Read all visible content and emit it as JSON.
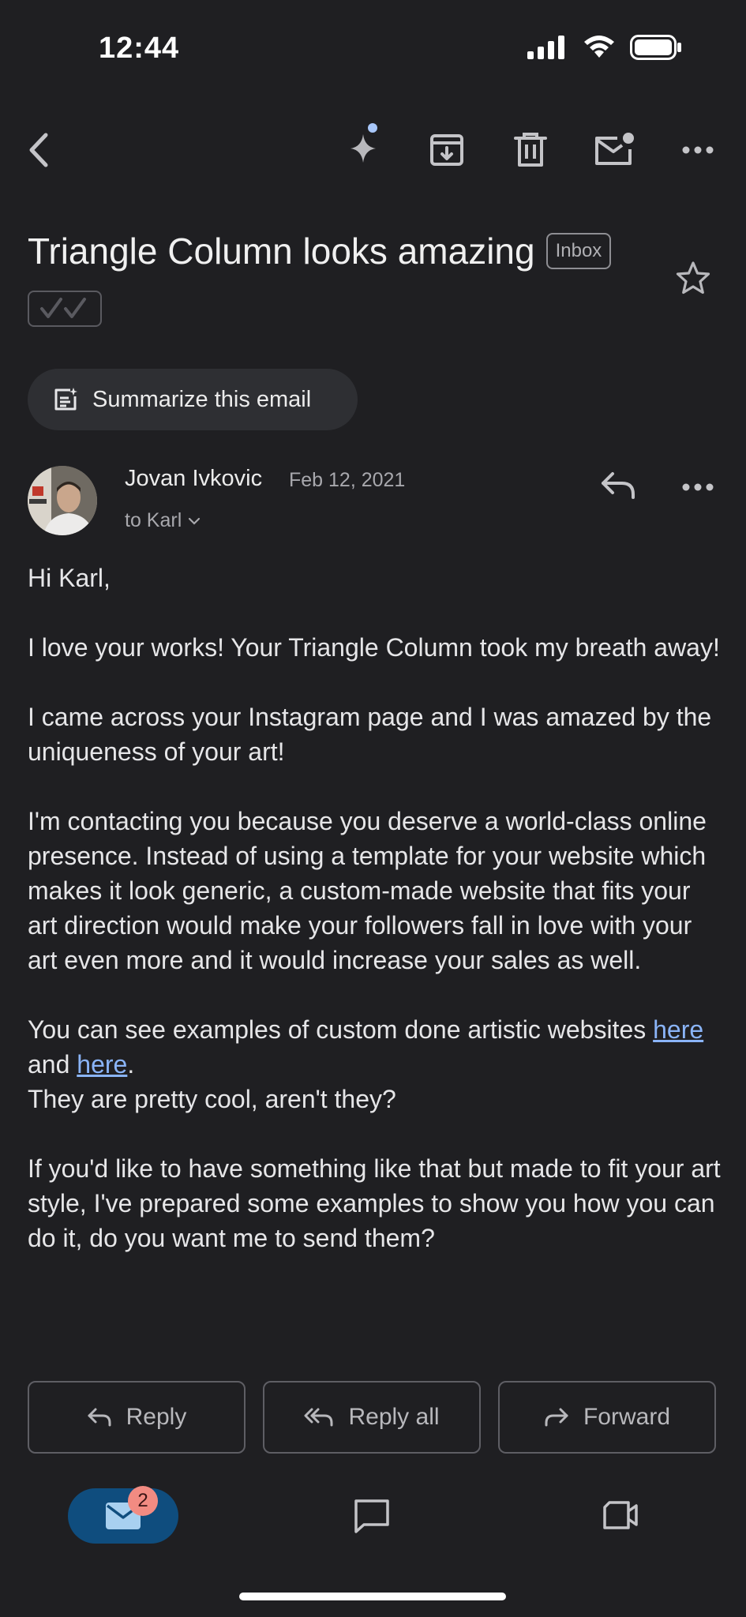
{
  "status_bar": {
    "time": "12:44"
  },
  "email": {
    "subject": "Triangle Column looks amazing",
    "label": "Inbox",
    "summarize_label": "Summarize this email",
    "sender": "Jovan Ivkovic",
    "date": "Feb 12, 2021",
    "recipient": "to Karl",
    "greeting": "Hi Karl,",
    "para1": "I love your works! Your Triangle Column took my breath away!",
    "para2": "I came across your Instagram page and I was amazed by the uniqueness of your art!",
    "para3": "I'm contacting you because you deserve a world-class online presence. Instead of using a template for your website which makes it look generic, a custom-made website that fits your art direction would make your followers fall in love with your art even more and it would increase your sales as well.",
    "para4_a": "You can see examples of custom done artistic websites ",
    "link1": "here",
    "para4_b": " and ",
    "link2": "here",
    "para4_c": ".",
    "para4_line2": "They are pretty cool, aren't they?",
    "para5": "If you'd like to have something like that but made to fit your art style, I've prepared some examples to show you how you can do it, do you want me to send them?"
  },
  "actions": {
    "reply": "Reply",
    "reply_all": "Reply all",
    "forward": "Forward"
  },
  "bottom_nav": {
    "mail_badge": "2"
  },
  "icons": {
    "back": "chevron-left-icon",
    "gemini": "sparkle-icon",
    "archive": "archive-icon",
    "delete": "trash-icon",
    "mark_unread": "mail-unread-icon",
    "more": "more-horizontal-icon",
    "star": "star-icon"
  },
  "colors": {
    "background": "#1f1f22",
    "link": "#8ab4f8",
    "accent_pill": "#0f4d7e",
    "badge": "#f28b82"
  }
}
